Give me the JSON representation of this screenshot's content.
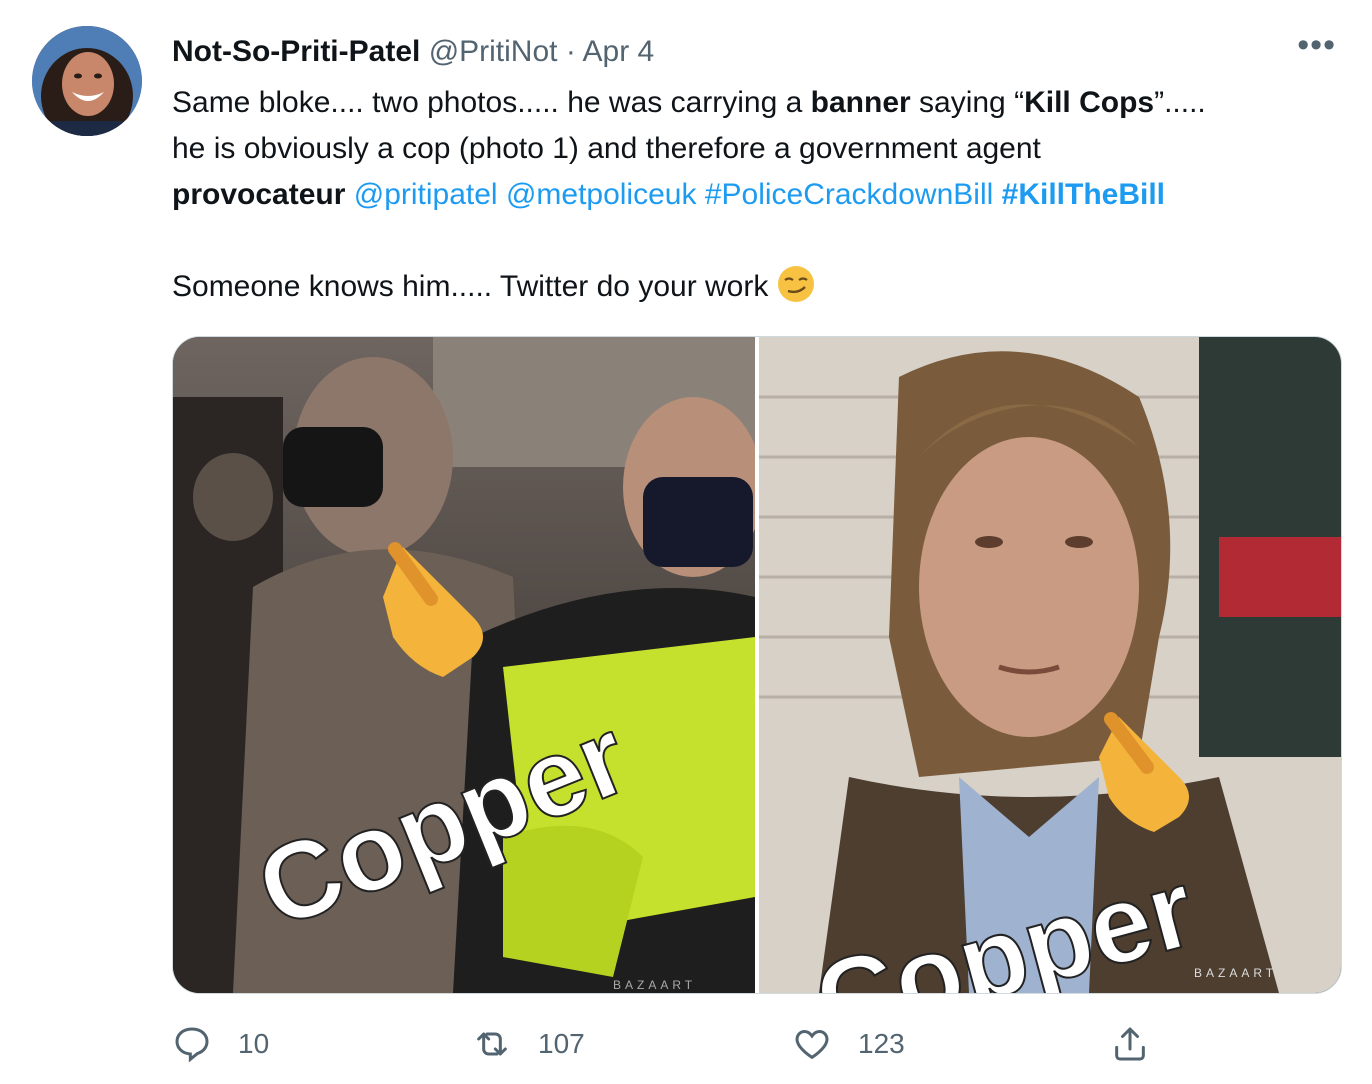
{
  "tweet": {
    "author_name": "Not-So-Priti-Patel",
    "handle": "@PritiNot",
    "separator": " · ",
    "date": "Apr 4",
    "more_icon": "more-icon",
    "text": {
      "l1_a": "Same bloke.... two photos..... he was carrying a ",
      "l1_b": "banner",
      "l1_c": " saying “",
      "l1_d": "Kill Cops",
      "l1_e": "”.....",
      "l2": "he is obviously a cop (photo 1) and therefore a government agent",
      "l3_a": "provocateur",
      "mention1": "@pritipatel",
      "mention2": "@metpoliceuk",
      "hashtag1": "#PoliceCrackdownBill",
      "hashtag2": "#KillTheBill",
      "l4": "Someone knows him..... Twitter do your work",
      "emoji": "smirk-face-emoji"
    },
    "media": {
      "left_caption": "Copper",
      "right_caption": "Copper",
      "watermark_right": "BAZAART",
      "watermark_left": "BAZAART"
    },
    "actions": {
      "reply_count": "10",
      "retweet_count": "107",
      "like_count": "123",
      "reply_icon": "reply-icon",
      "retweet_icon": "retweet-icon",
      "like_icon": "heart-icon",
      "share_icon": "share-icon"
    }
  }
}
